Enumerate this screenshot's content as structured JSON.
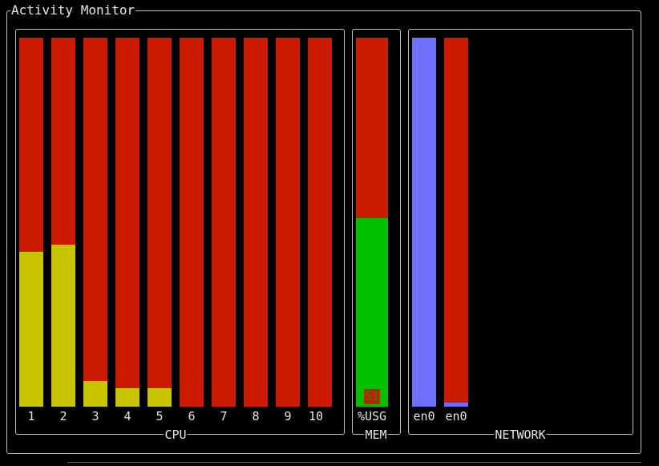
{
  "window": {
    "title": "Activity Monitor"
  },
  "colors": {
    "background": "#000000",
    "border": "#bdbdbd",
    "track_red": "#cc1a00",
    "cpu_yellow": "#c8c400",
    "mem_green": "#00c000",
    "net_blue": "#6e6eff"
  },
  "panels": {
    "cpu": {
      "label": "CPU",
      "bars": [
        {
          "label": "1",
          "percent": 42
        },
        {
          "label": "2",
          "percent": 44
        },
        {
          "label": "3",
          "percent": 7
        },
        {
          "label": "4",
          "percent": 5
        },
        {
          "label": "5",
          "percent": 5
        },
        {
          "label": "6",
          "percent": 0
        },
        {
          "label": "7",
          "percent": 0
        },
        {
          "label": "8",
          "percent": 0
        },
        {
          "label": "9",
          "percent": 0
        },
        {
          "label": "10",
          "percent": 0
        }
      ]
    },
    "mem": {
      "label": "MEM",
      "bars": [
        {
          "label": "%USG",
          "percent": 51,
          "value_text": "51"
        }
      ]
    },
    "network": {
      "label": "NETWORK",
      "bars": [
        {
          "label": "en0",
          "percent": 100
        },
        {
          "label": "en0",
          "percent": 1
        }
      ]
    }
  }
}
